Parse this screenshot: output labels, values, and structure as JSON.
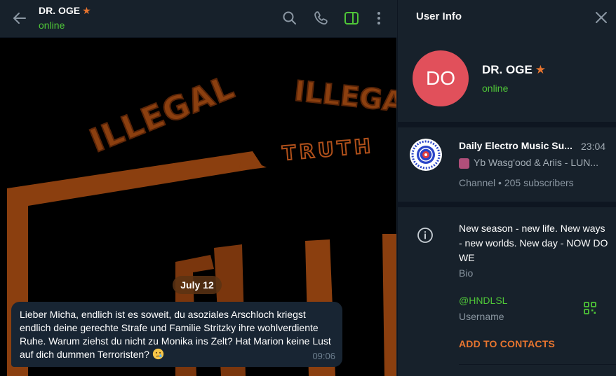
{
  "chat_header": {
    "name": "DR. OGE",
    "status": "online"
  },
  "chat": {
    "wallpaper_texts": [
      "ILLEGAL",
      "ILLEGAL",
      "TRUTH"
    ],
    "date_label": "July 12",
    "message": {
      "text": "Lieber Micha, endlich ist es soweit, du asoziales Arschloch kriegst endlich deine gerechte Strafe und Familie Stritzky ihre wohlverdiente Ruhe. Warum ziehst du nicht zu Monika ins Zelt? Hat Marion keine Lust auf dich dummen Terroristen?",
      "emoji": "crying-face",
      "time": "09:06"
    }
  },
  "user_info": {
    "title": "User Info",
    "avatar_initials": "DO",
    "name": "DR. OGE",
    "status": "online",
    "channel": {
      "name": "Daily Electro Music Su...",
      "time": "23:04",
      "last_message": "Yb Wasg'ood & Ariis - LUN...",
      "subscribers": "Channel • 205 subscribers"
    },
    "bio": "New season - new life. New ways - new worlds. New day - NOW DO WE",
    "bio_label": "Bio",
    "username": "@HNDLSL",
    "username_label": "Username",
    "add_contacts": "ADD TO CONTACTS"
  },
  "colors": {
    "panel_bg": "#17212b",
    "accent_green": "#4fc638",
    "accent_orange": "#e8752f",
    "avatar_red": "#e1505b",
    "bubble_bg": "#182533"
  },
  "icons": [
    "back-arrow-icon",
    "search-icon",
    "phone-icon",
    "sidebar-toggle-icon",
    "more-vertical-icon",
    "close-icon",
    "star-icon",
    "info-icon",
    "qr-code-icon"
  ]
}
